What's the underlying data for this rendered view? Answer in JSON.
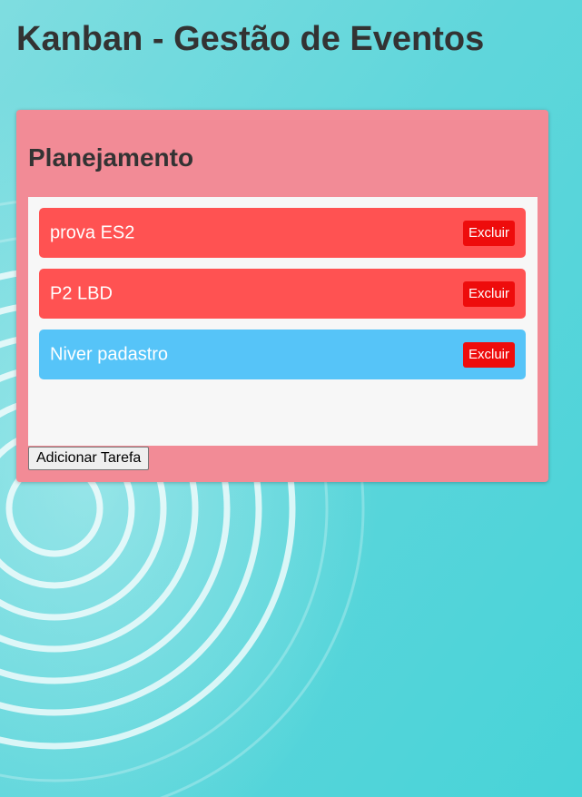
{
  "page": {
    "title": "Kanban - Gestão de Eventos"
  },
  "column": {
    "title": "Planejamento",
    "add_button_label": "Adicionar Tarefa",
    "tasks": [
      {
        "label": "prova ES2",
        "color": "#ff5252",
        "delete_label": "Excluir"
      },
      {
        "label": "P2 LBD",
        "color": "#ff5252",
        "delete_label": "Excluir"
      },
      {
        "label": "Niver padastro",
        "color": "#56c4f8",
        "delete_label": "Excluir"
      }
    ]
  },
  "colors": {
    "background": "#4fd3d9",
    "column": "#f28b96",
    "delete_button": "#ee0c0c",
    "title_text": "#333333"
  }
}
